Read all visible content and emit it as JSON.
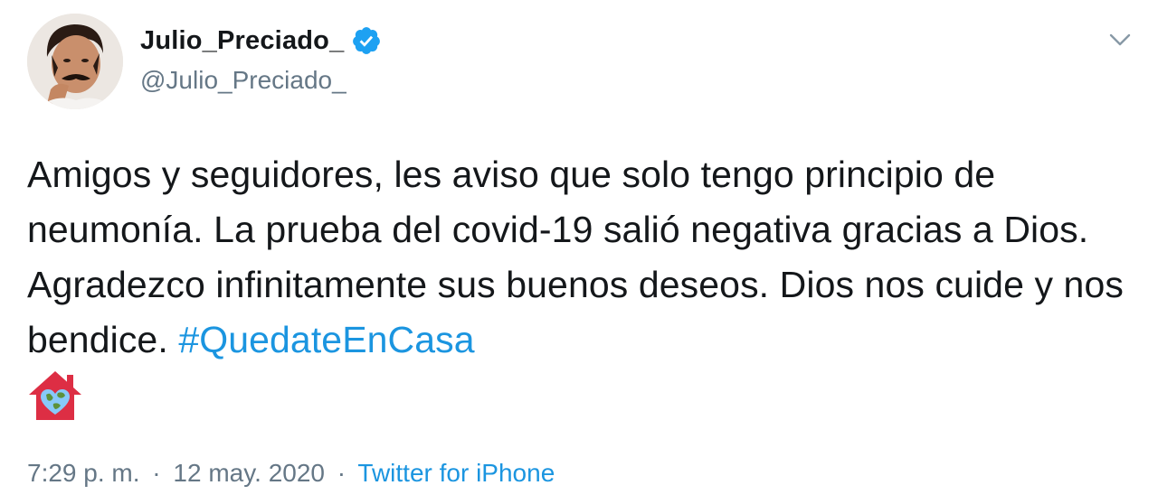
{
  "author": {
    "display_name": "Julio_Preciado_",
    "handle": "@Julio_Preciado_",
    "verified": true,
    "verified_color": "#1da1f2"
  },
  "tweet": {
    "text": "Amigos y seguidores, les aviso que solo tengo principio de neumonía. La prueba del covid-19 salió negativa gracias a Dios. Agradezco infinitamente sus buenos deseos. Dios nos cuide y nos bendice. ",
    "hashtag": "#QuedateEnCasa",
    "emoji": "house-with-earth-heart-icon"
  },
  "meta": {
    "time": "7:29 p. m.",
    "separator": "·",
    "date": "12 may. 2020",
    "source": "Twitter for iPhone"
  },
  "colors": {
    "text": "#14171a",
    "secondary": "#657786",
    "link": "#1b95e0"
  }
}
